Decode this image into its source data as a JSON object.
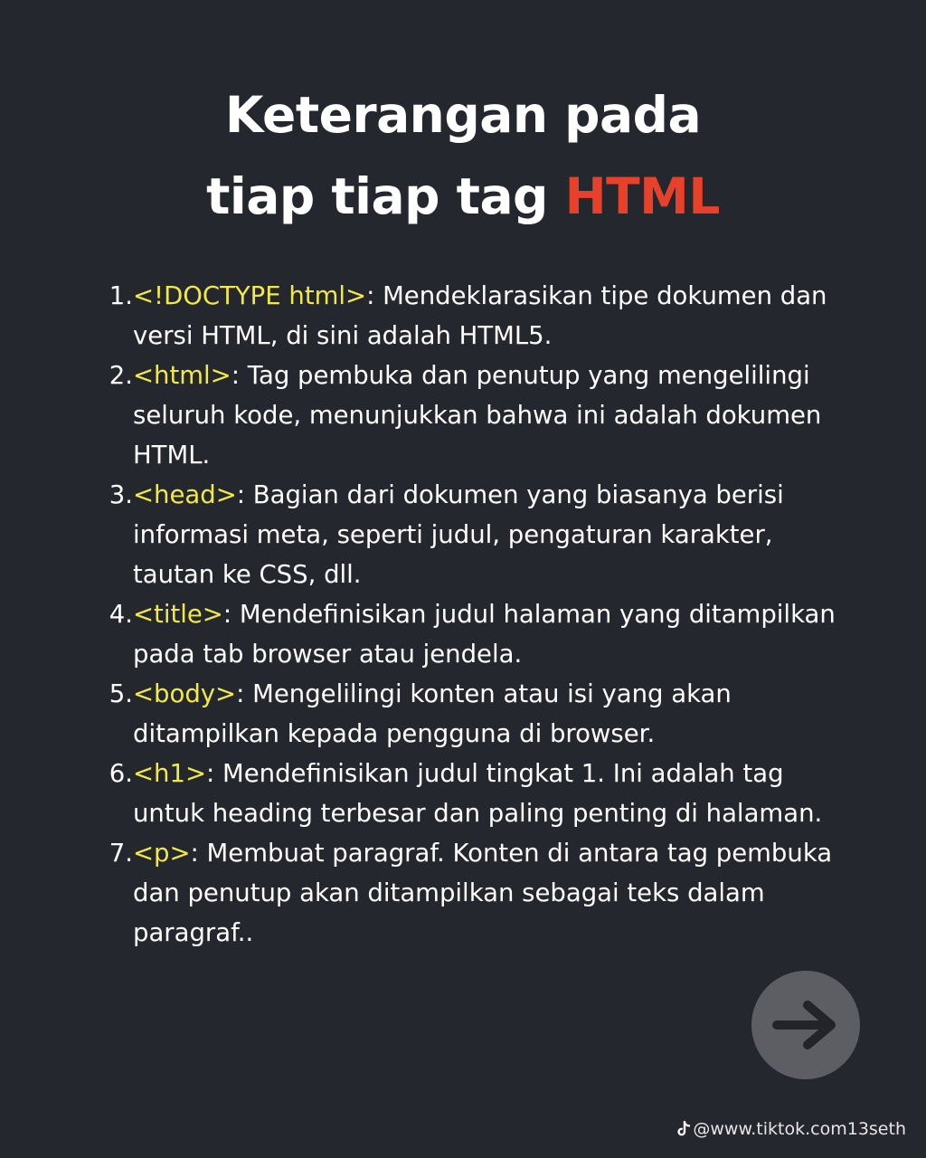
{
  "title": {
    "line1": "Keterangan pada",
    "line2_prefix": "tiap tiap tag ",
    "line2_accent": "HTML"
  },
  "items": [
    {
      "num": "1.",
      "tag": "<!DOCTYPE html>",
      "desc": ": Mendeklarasikan tipe dokumen dan versi HTML, di sini adalah HTML5."
    },
    {
      "num": "2.",
      "tag": "<html>",
      "desc": ": Tag pembuka dan penutup yang mengelilingi seluruh kode, menunjukkan bahwa ini adalah dokumen HTML."
    },
    {
      "num": "3.",
      "tag": "<head>",
      "desc": ": Bagian dari dokumen yang biasanya berisi informasi meta, seperti judul, pengaturan karakter, tautan ke CSS, dll."
    },
    {
      "num": "4.",
      "tag": "<title>",
      "desc": ": Mendefinisikan judul halaman yang ditampilkan pada tab browser atau jendela."
    },
    {
      "num": "5.",
      "tag": "<body>",
      "desc": ": Mengelilingi konten atau isi yang akan ditampilkan kepada pengguna di browser."
    },
    {
      "num": "6.",
      "tag": "<h1>",
      "desc": ": Mendefinisikan judul tingkat 1. Ini adalah tag untuk heading terbesar dan paling penting di halaman."
    },
    {
      "num": "7.",
      "tag": "<p>",
      "desc": ": Membuat paragraf. Konten di antara tag pembuka dan penutup akan ditampilkan sebagai teks dalam paragraf.."
    }
  ],
  "next_button": {
    "icon": "arrow-right-icon"
  },
  "watermark": {
    "icon": "tiktok-icon",
    "text": "@www.tiktok.com13seth"
  },
  "colors": {
    "background": "#25272e",
    "accent": "#e8412b",
    "tag": "#f1e84a",
    "text": "#ffffff",
    "button": "#5c5e63"
  }
}
